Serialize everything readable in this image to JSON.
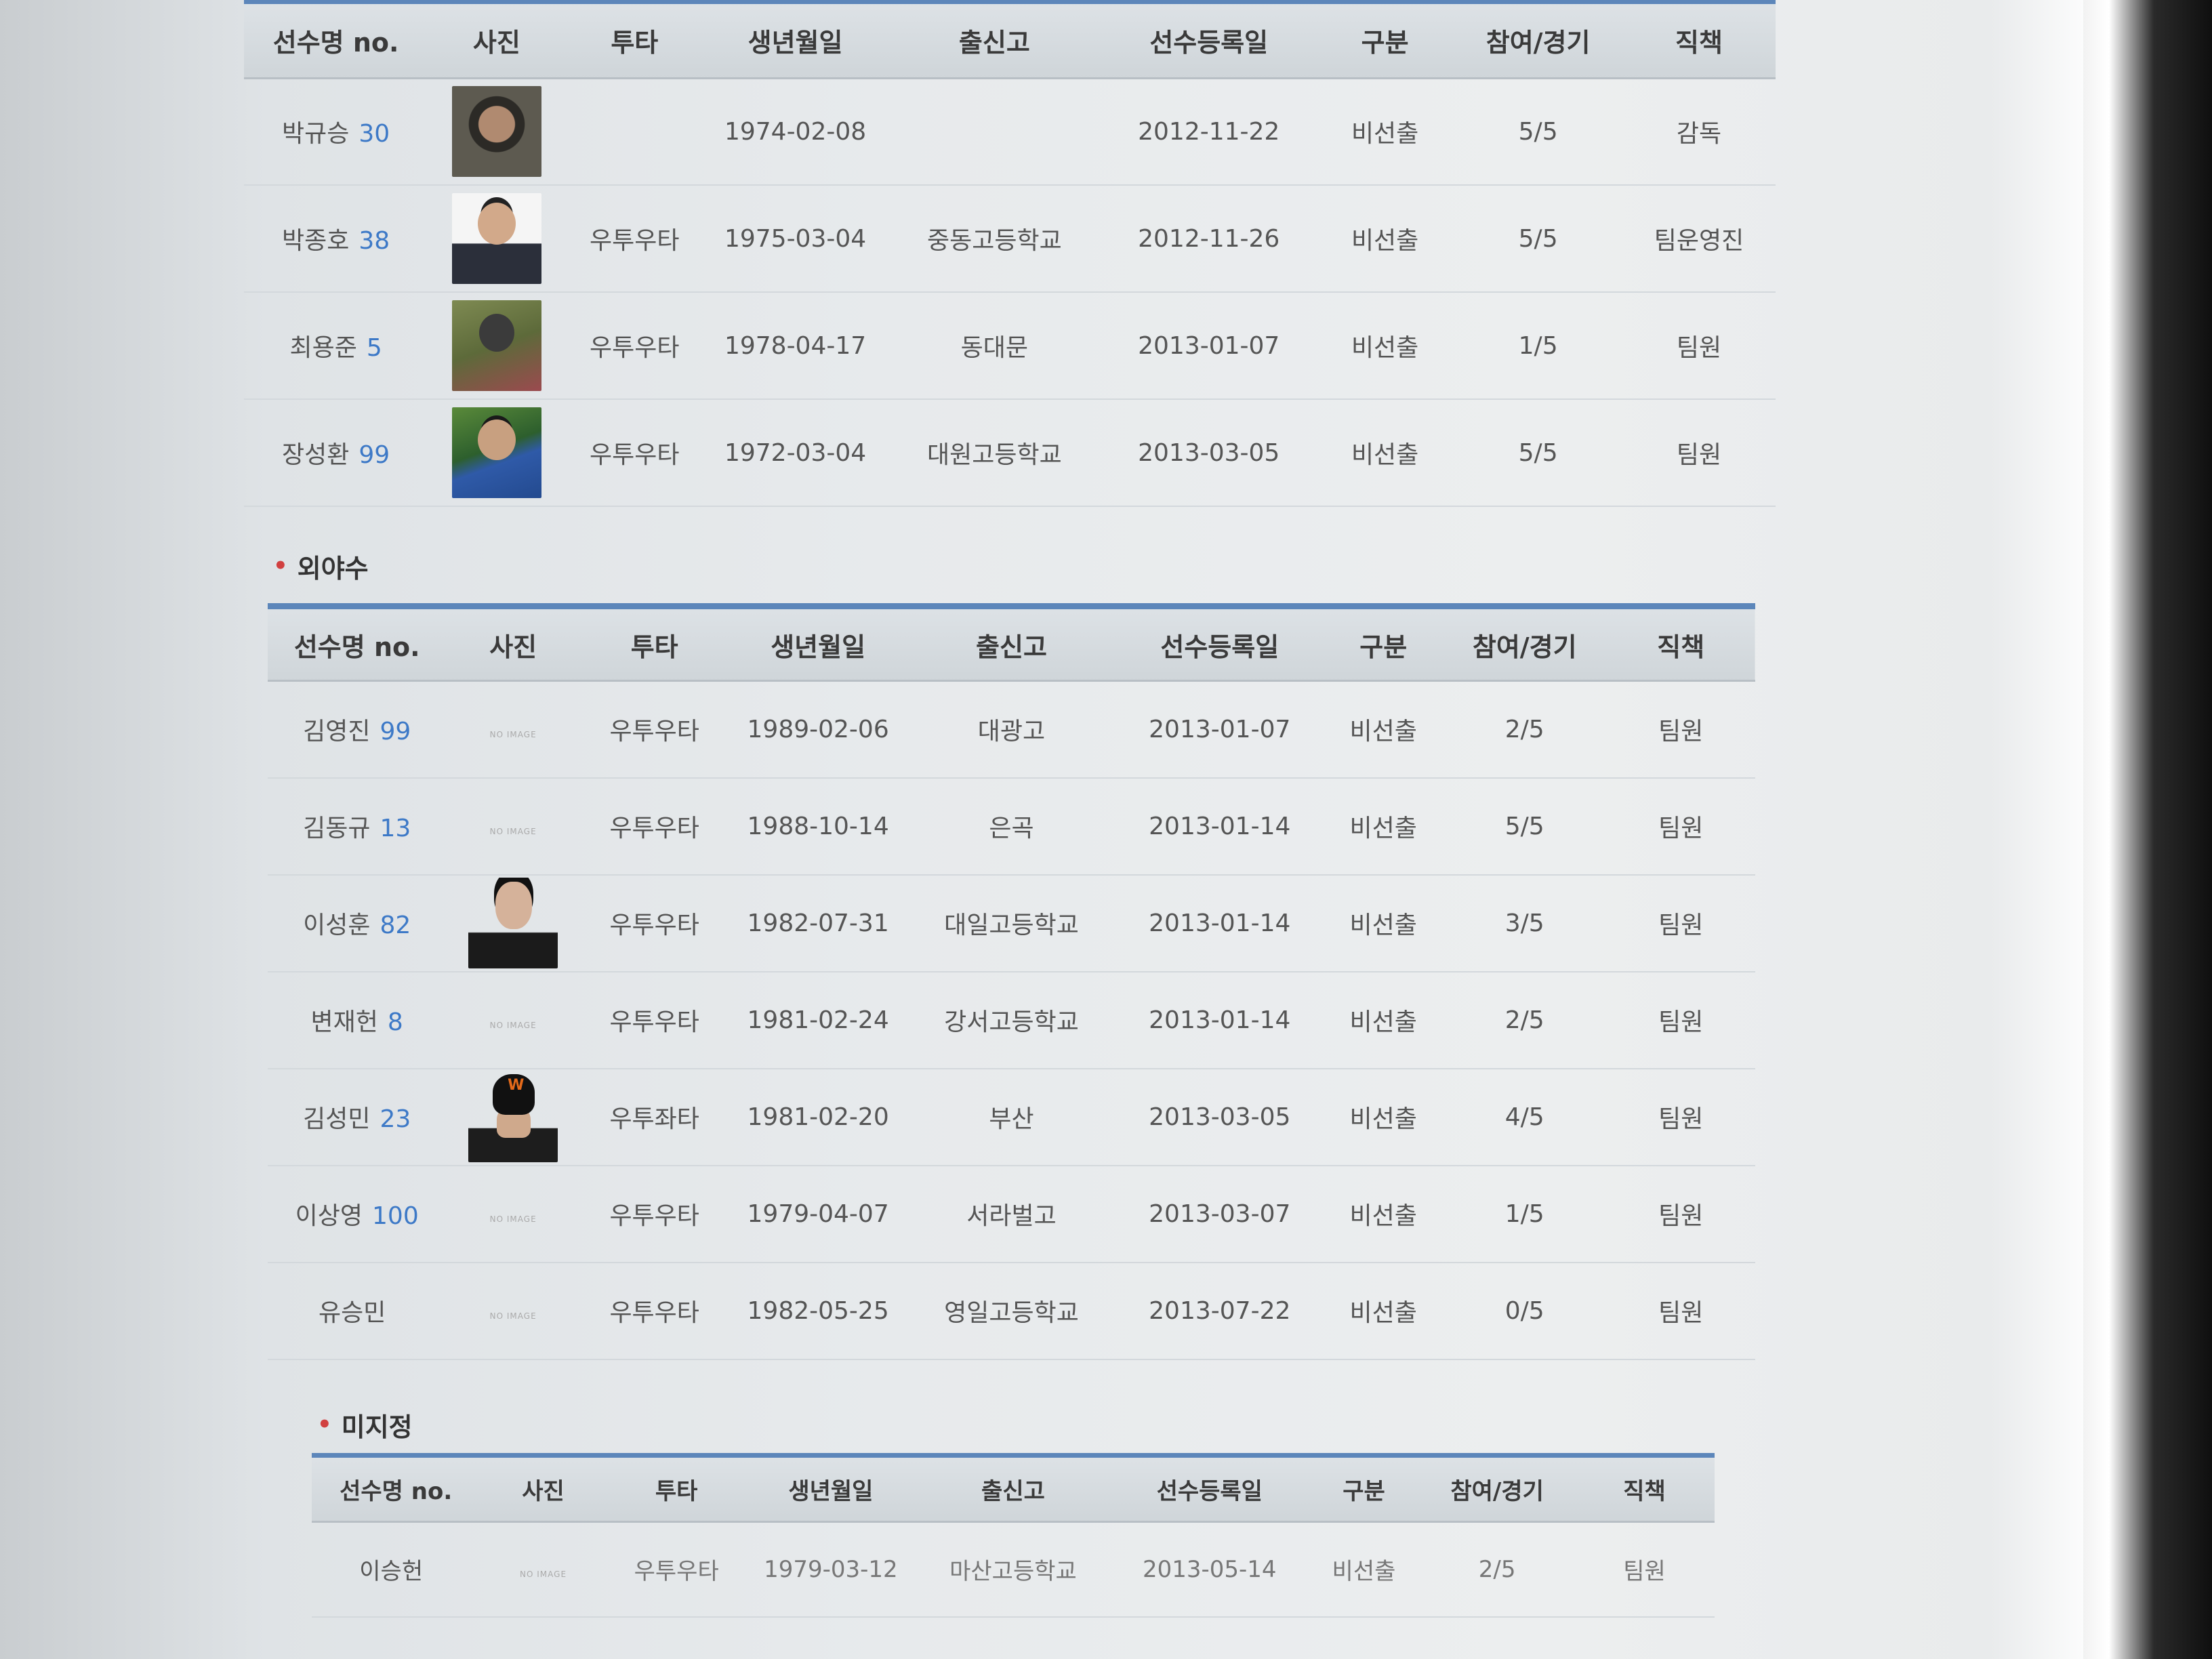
{
  "headers": [
    "선수명 no.",
    "사진",
    "투타",
    "생년월일",
    "출신고",
    "선수등록일",
    "구분",
    "참여/경기",
    "직책"
  ],
  "infield": {
    "rows": [
      {
        "name": "박규승",
        "no": "30",
        "photo": "player-photo",
        "bat": "",
        "birth": "1974-02-08",
        "school": "",
        "registered": "2012-11-22",
        "type": "비선출",
        "games": "5/5",
        "role": "감독"
      },
      {
        "name": "박종호",
        "no": "38",
        "photo": "player-photo",
        "bat": "우투우타",
        "birth": "1975-03-04",
        "school": "중동고등학교",
        "registered": "2012-11-26",
        "type": "비선출",
        "games": "5/5",
        "role": "팀운영진"
      },
      {
        "name": "최용준",
        "no": "5",
        "photo": "player-photo",
        "bat": "우투우타",
        "birth": "1978-04-17",
        "school": "동대문",
        "registered": "2013-01-07",
        "type": "비선출",
        "games": "1/5",
        "role": "팀원"
      },
      {
        "name": "장성환",
        "no": "99",
        "photo": "player-photo",
        "bat": "우투우타",
        "birth": "1972-03-04",
        "school": "대원고등학교",
        "registered": "2013-03-05",
        "type": "비선출",
        "games": "5/5",
        "role": "팀원"
      }
    ]
  },
  "outfield": {
    "title": "외야수",
    "rows": [
      {
        "name": "김영진",
        "no": "99",
        "bat": "우투우타",
        "birth": "1989-02-06",
        "school": "대광고",
        "registered": "2013-01-07",
        "type": "비선출",
        "games": "2/5",
        "role": "팀원"
      },
      {
        "name": "김동규",
        "no": "13",
        "bat": "우투우타",
        "birth": "1988-10-14",
        "school": "은곡",
        "registered": "2013-01-14",
        "type": "비선출",
        "games": "5/5",
        "role": "팀원"
      },
      {
        "name": "이성훈",
        "no": "82",
        "bat": "우투우타",
        "birth": "1982-07-31",
        "school": "대일고등학교",
        "registered": "2013-01-14",
        "type": "비선출",
        "games": "3/5",
        "role": "팀원"
      },
      {
        "name": "변재헌",
        "no": "8",
        "bat": "우투우타",
        "birth": "1981-02-24",
        "school": "강서고등학교",
        "registered": "2013-01-14",
        "type": "비선출",
        "games": "2/5",
        "role": "팀원"
      },
      {
        "name": "김성민",
        "no": "23",
        "bat": "우투좌타",
        "birth": "1981-02-20",
        "school": "부산",
        "registered": "2013-03-05",
        "type": "비선출",
        "games": "4/5",
        "role": "팀원"
      },
      {
        "name": "이상영",
        "no": "100",
        "bat": "우투우타",
        "birth": "1979-04-07",
        "school": "서라벌고",
        "registered": "2013-03-07",
        "type": "비선출",
        "games": "1/5",
        "role": "팀원"
      },
      {
        "name": "유승민",
        "no": "",
        "bat": "우투우타",
        "birth": "1982-05-25",
        "school": "영일고등학교",
        "registered": "2013-07-22",
        "type": "비선출",
        "games": "0/5",
        "role": "팀원"
      }
    ]
  },
  "undecided": {
    "title": "미지정",
    "rows": [
      {
        "name": "이승헌",
        "no": "",
        "bat": "우투우타",
        "birth": "1979-03-12",
        "school": "마산고등학교",
        "registered": "2013-05-14",
        "type": "비선출",
        "games": "2/5",
        "role": "팀원"
      }
    ]
  },
  "no_image_label": "NO IMAGE",
  "colors": {
    "accent_line": "#5c86ba",
    "number": "#3d79c7",
    "bullet": "#d14040"
  }
}
